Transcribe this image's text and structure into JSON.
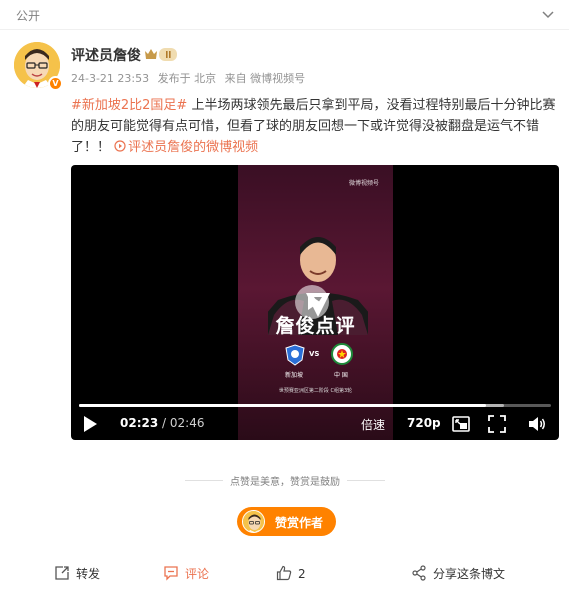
{
  "post": {
    "visibility": "公开",
    "author": {
      "name": "评述员詹俊",
      "verified": true
    },
    "meta": {
      "time": "24-3-21 23:53",
      "location": "发布于 北京",
      "source": "来自 微博视频号"
    },
    "hashtag": "#新加坡2比2国足#",
    "body_text": " 上半场两球领先最后只拿到平局，没看过程特别最后十分钟比赛的朋友可能觉得有点可惜，但看了球的朋友回想一下或许觉得没被翻盘是运气不错了！！",
    "video_link": "评述员詹俊的微博视频"
  },
  "video": {
    "poster": {
      "brand": "微博视频号",
      "title": "詹俊点评",
      "team_a": "新加坡",
      "team_b": "中 国",
      "vs": "VS",
      "subtitle": "世预赛亚洲区第二阶段 C组第3轮"
    },
    "current_time": "02:23",
    "separator": "/",
    "duration": "02:46",
    "progress": 0.862,
    "buffered": 0.9,
    "speed_label": "倍速",
    "quality_label": "720p",
    "icons": [
      "play-icon",
      "picture-in-picture-icon",
      "fullscreen-icon",
      "volume-icon"
    ]
  },
  "reward": {
    "slogan": "点赞是美意，赞赏是鼓励",
    "button_label": "赞赏作者"
  },
  "actions": {
    "repost": "转发",
    "comment": "评论",
    "like_count": "2",
    "share": "分享这条博文"
  },
  "colors": {
    "link": "#eb7350",
    "accent": "#ff8200",
    "muted": "#939393"
  }
}
